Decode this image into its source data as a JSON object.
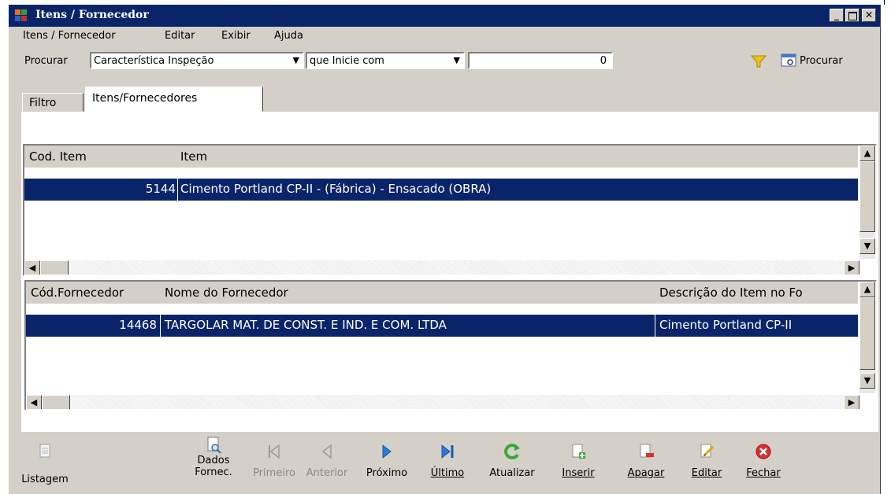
{
  "window": {
    "title": "Itens / Fornecedor"
  },
  "menu": [
    "Itens / Fornecedor",
    "Editar",
    "Exibir",
    "Ajuda"
  ],
  "search": {
    "label": "Procurar",
    "field": "Característica Inspeção",
    "mode": "que Inicie com",
    "value": "0",
    "button": "Procurar"
  },
  "tabs": [
    "Filtro",
    "Itens/Fornecedores"
  ],
  "items_grid": {
    "headers": [
      "Cod. Item",
      "Item"
    ],
    "rows": [
      {
        "code": "5144",
        "item": "Cimento Portland CP-II - (Fábrica) - Ensacado (OBRA)"
      }
    ]
  },
  "suppliers_grid": {
    "headers": [
      "Cód.Fornecedor",
      "Nome do Fornecedor",
      "Descrição do Item no Fo"
    ],
    "rows": [
      {
        "code": "14468",
        "name": "TARGOLAR MAT. DE CONST. E IND. E COM. LTDA",
        "desc": "Cimento Portland CP-II"
      }
    ]
  },
  "toolbar": {
    "listagem": "Listagem",
    "dados_1": "Dados",
    "dados_2": "Fornec.",
    "primeiro": "Primeiro",
    "anterior": "Anterior",
    "proximo": "Próximo",
    "ultimo": "Último",
    "atualizar": "Atualizar",
    "inserir": "Inserir",
    "apagar": "Apagar",
    "editar": "Editar",
    "fechar": "Fechar"
  },
  "colors": {
    "titlebar": "#0a246a",
    "selection": "#0a246a",
    "face": "#d4d0c8"
  }
}
